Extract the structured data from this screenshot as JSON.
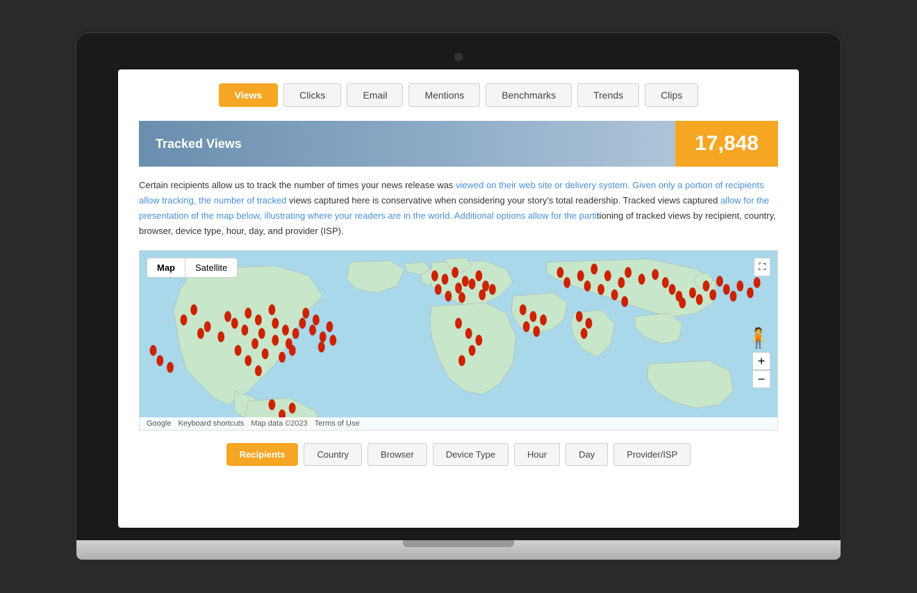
{
  "laptop": {
    "screen_bg": "#fff"
  },
  "tabs": {
    "items": [
      {
        "label": "Views",
        "active": true
      },
      {
        "label": "Clicks",
        "active": false
      },
      {
        "label": "Email",
        "active": false
      },
      {
        "label": "Mentions",
        "active": false
      },
      {
        "label": "Benchmarks",
        "active": false
      },
      {
        "label": "Trends",
        "active": false
      },
      {
        "label": "Clips",
        "active": false
      }
    ]
  },
  "tracked_views": {
    "title": "Tracked Views",
    "count": "17,848"
  },
  "description": {
    "text_plain": "Certain recipients allow us to track the number of times your news release was viewed on their web site or delivery system. Given only a portion of recipients allow tracking, the number of tracked views captured here is conservative when considering your story's total readership. Tracked views captured allow for the presentation of the map below, illustrating where your readers are in the world. Additional options allow for the partitioning of tracked views by recipient, country, browser, device type, hour, day, and provider (ISP)."
  },
  "map": {
    "toggle_map": "Map",
    "toggle_satellite": "Satellite",
    "footer_google": "Google",
    "footer_keyboard": "Keyboard shortcuts",
    "footer_data": "Map data ©2023",
    "footer_terms": "Terms of Use"
  },
  "filter_bar": {
    "items": [
      {
        "label": "Recipients",
        "active": true
      },
      {
        "label": "Country",
        "active": false
      },
      {
        "label": "Browser",
        "active": false
      },
      {
        "label": "Device Type",
        "active": false
      },
      {
        "label": "Hour",
        "active": false
      },
      {
        "label": "Day",
        "active": false
      },
      {
        "label": "Provider/ISP",
        "active": false
      }
    ]
  }
}
